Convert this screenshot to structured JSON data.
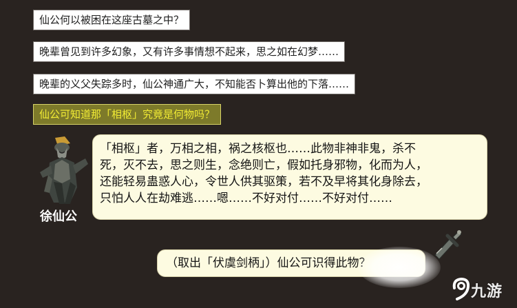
{
  "choices": [
    {
      "text": "仙公何以被困在这座古墓之中？"
    },
    {
      "text": "晚辈曾见到许多幻象，又有许多事情想不起来，思之如在幻梦……"
    },
    {
      "text": "晚辈的义父失踪多时，仙公神通广大，不知能否卜算出他的下落……"
    },
    {
      "text": "仙公可知道那「相枢」究竟是何物吗？"
    }
  ],
  "npc": {
    "name": "徐仙公",
    "lines": [
      "「相枢」者，万相之相，祸之核枢也……此物非神非鬼，杀不",
      "死，灭不去，思之则生，念绝则亡，假如托身邪物，化而为人，",
      "还能轻易蛊惑人心，令世人供其驱策，若不及早将其化身除去，",
      "只怕人人在劫难逃……嗯……不好对付……不好对付……"
    ]
  },
  "player": {
    "line": "（取出「伏虞剑柄」）仙公可识得此物？"
  },
  "watermark": {
    "text": "九游"
  },
  "colors": {
    "background": "#292320",
    "choice_selected_text": "#f2ec34",
    "choice_selected_bg": "#7d7a2a",
    "bubble_bg": "#fdfbe1"
  }
}
